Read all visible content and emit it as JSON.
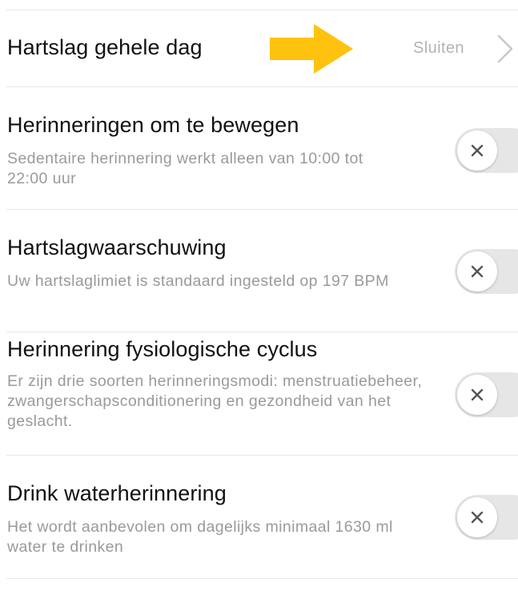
{
  "heart_rate_row": {
    "title": "Hartslag gehele dag",
    "value": "Sluiten",
    "arrow_color": "#FFC20E"
  },
  "toggle_rows": [
    {
      "title": "Herinneringen om te bewegen",
      "description": "Sedentaire herinnering werkt alleen van 10:00 tot 22:00 uur",
      "enabled": false
    },
    {
      "title": "Hartslagwaarschuwing",
      "description": "Uw hartslaglimiet is standaard ingesteld op 197 BPM",
      "enabled": false
    },
    {
      "title": "Herinnering fysiologische cyclus",
      "description": "Er zijn drie soorten herinneringsmodi: menstruatiebeheer, zwangerschapsconditionering en gezondheid van het geslacht.",
      "enabled": false
    },
    {
      "title": "Drink waterherinnering",
      "description": "Het wordt aanbevolen om dagelijks minimaal 1630 ml water te drinken",
      "enabled": false
    }
  ],
  "colors": {
    "title_text": "#111111",
    "secondary_text": "#9a9a9a",
    "toggle_off_track": "#e6e6e6",
    "divider": "#e7e7e7"
  }
}
